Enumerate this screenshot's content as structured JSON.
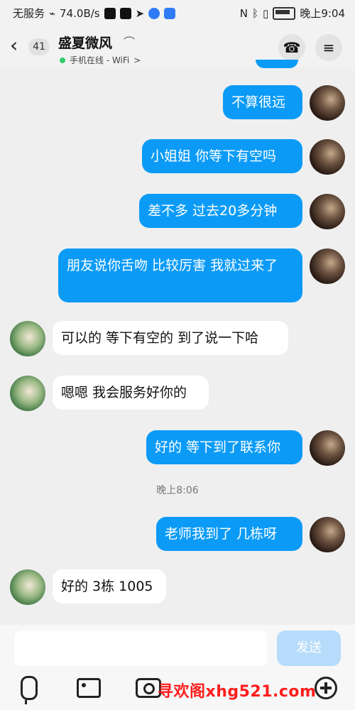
{
  "status_bar": {
    "left_text": "无服务",
    "speed": "74.0B/s",
    "time": "晚上9:04"
  },
  "header": {
    "back_count": "41",
    "title": "盛夏微风",
    "status": "手机在线 - WiFi",
    "status_chevron": ">"
  },
  "messages": [
    {
      "side": "out",
      "text": "不算很远"
    },
    {
      "side": "out",
      "text": "小姐姐 你等下有空吗"
    },
    {
      "side": "out",
      "text": "差不多 过去20多分钟"
    },
    {
      "side": "out",
      "text": "朋友说你舌吻 比较厉害 我就过来了"
    },
    {
      "side": "in",
      "text": "可以的 等下有空的 到了说一下哈"
    },
    {
      "side": "in",
      "text": "嗯嗯 我会服务好你的"
    },
    {
      "side": "out",
      "text": "好的 等下到了联系你"
    },
    {
      "side": "time",
      "text": "晚上8:06"
    },
    {
      "side": "out",
      "text": "老师我到了 几栋呀"
    },
    {
      "side": "in",
      "text": "好的 3栋 1005"
    }
  ],
  "input": {
    "send_label": "发送"
  },
  "watermark": "寻欢阁xhg521.com",
  "colors": {
    "outgoing": "#0b9bf7",
    "incoming": "#ffffff",
    "background": "#efefef",
    "send_disabled": "#b7dcfb"
  }
}
